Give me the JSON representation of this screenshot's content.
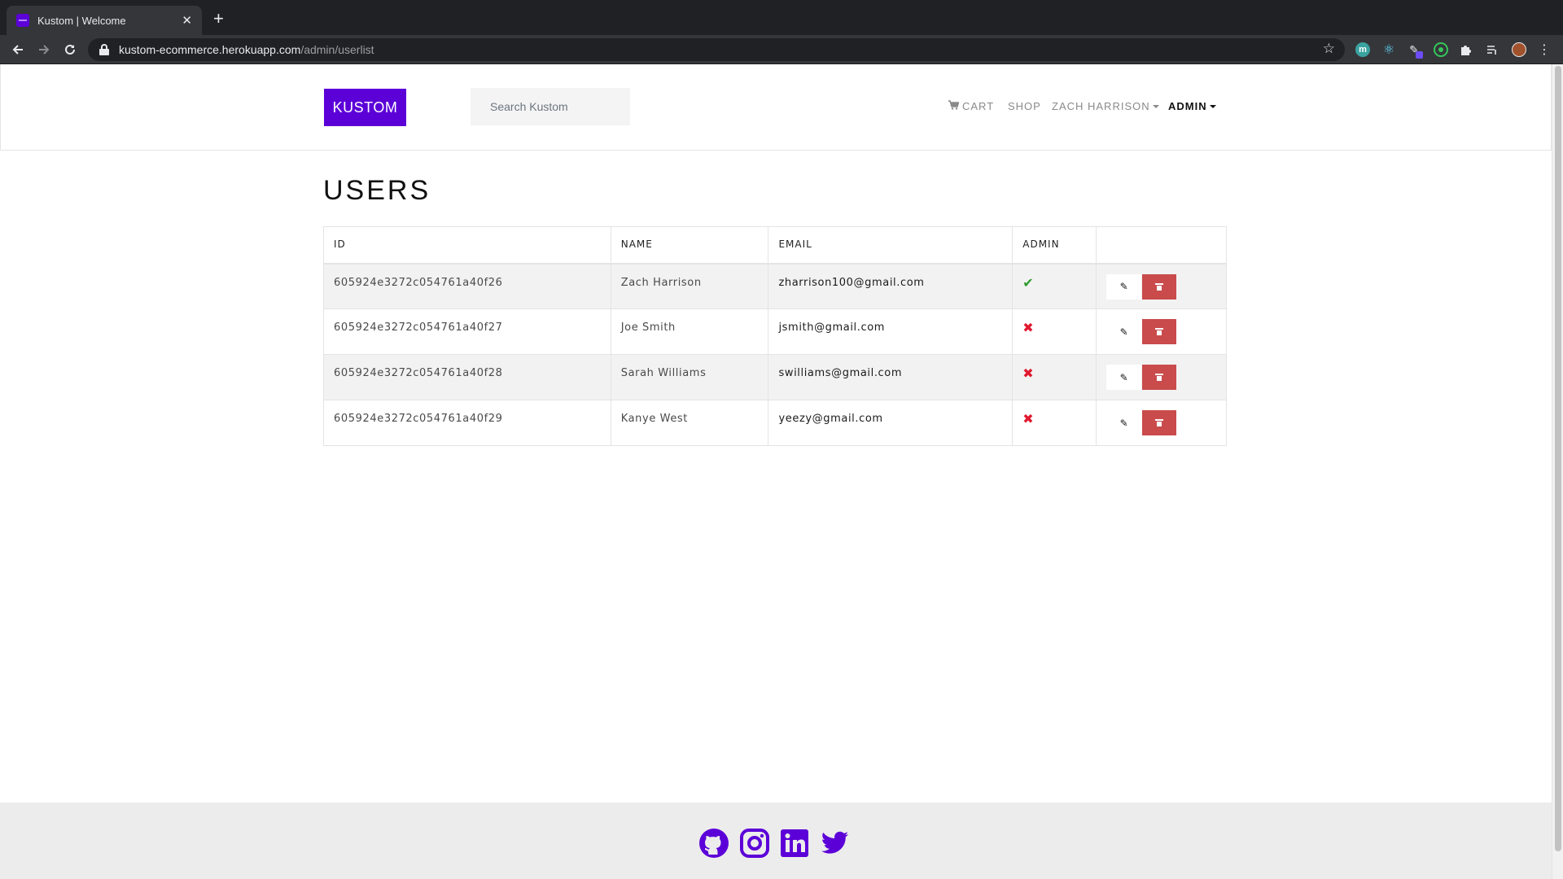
{
  "browser": {
    "tab_title": "Kustom | Welcome",
    "tab_close": "✕",
    "new_tab": "+",
    "url_host": "kustom-ecommerce.herokuapp.com",
    "url_path": "/admin/userlist",
    "extension_m": "m"
  },
  "header": {
    "brand": "KUSTOM",
    "search_placeholder": "Search Kustom",
    "nav": {
      "cart": "CART",
      "shop": "SHOP",
      "user": "ZACH HARRISON",
      "admin": "ADMIN"
    }
  },
  "main": {
    "title": "USERS",
    "table": {
      "headers": {
        "id": "ID",
        "name": "NAME",
        "email": "EMAIL",
        "admin": "ADMIN",
        "actions": ""
      },
      "rows": [
        {
          "id": "605924e3272c054761a40f26",
          "name": "Zach Harrison",
          "email": "zharrison100@gmail.com",
          "admin": true,
          "admin_glyph": "✔"
        },
        {
          "id": "605924e3272c054761a40f27",
          "name": "Joe Smith",
          "email": "jsmith@gmail.com",
          "admin": false,
          "admin_glyph": "✖"
        },
        {
          "id": "605924e3272c054761a40f28",
          "name": "Sarah Williams",
          "email": "swilliams@gmail.com",
          "admin": false,
          "admin_glyph": "✖"
        },
        {
          "id": "605924e3272c054761a40f29",
          "name": "Kanye West",
          "email": "yeezy@gmail.com",
          "admin": false,
          "admin_glyph": "✖"
        }
      ]
    }
  },
  "footer": {
    "social_icons": [
      "github-icon",
      "instagram-icon",
      "linkedin-icon",
      "twitter-icon"
    ]
  },
  "colors": {
    "brand": "#5c00d8",
    "delete": "#c94b4b",
    "check": "#2e9b2e",
    "cross": "#e0192f",
    "footer_bg": "#ececec"
  }
}
